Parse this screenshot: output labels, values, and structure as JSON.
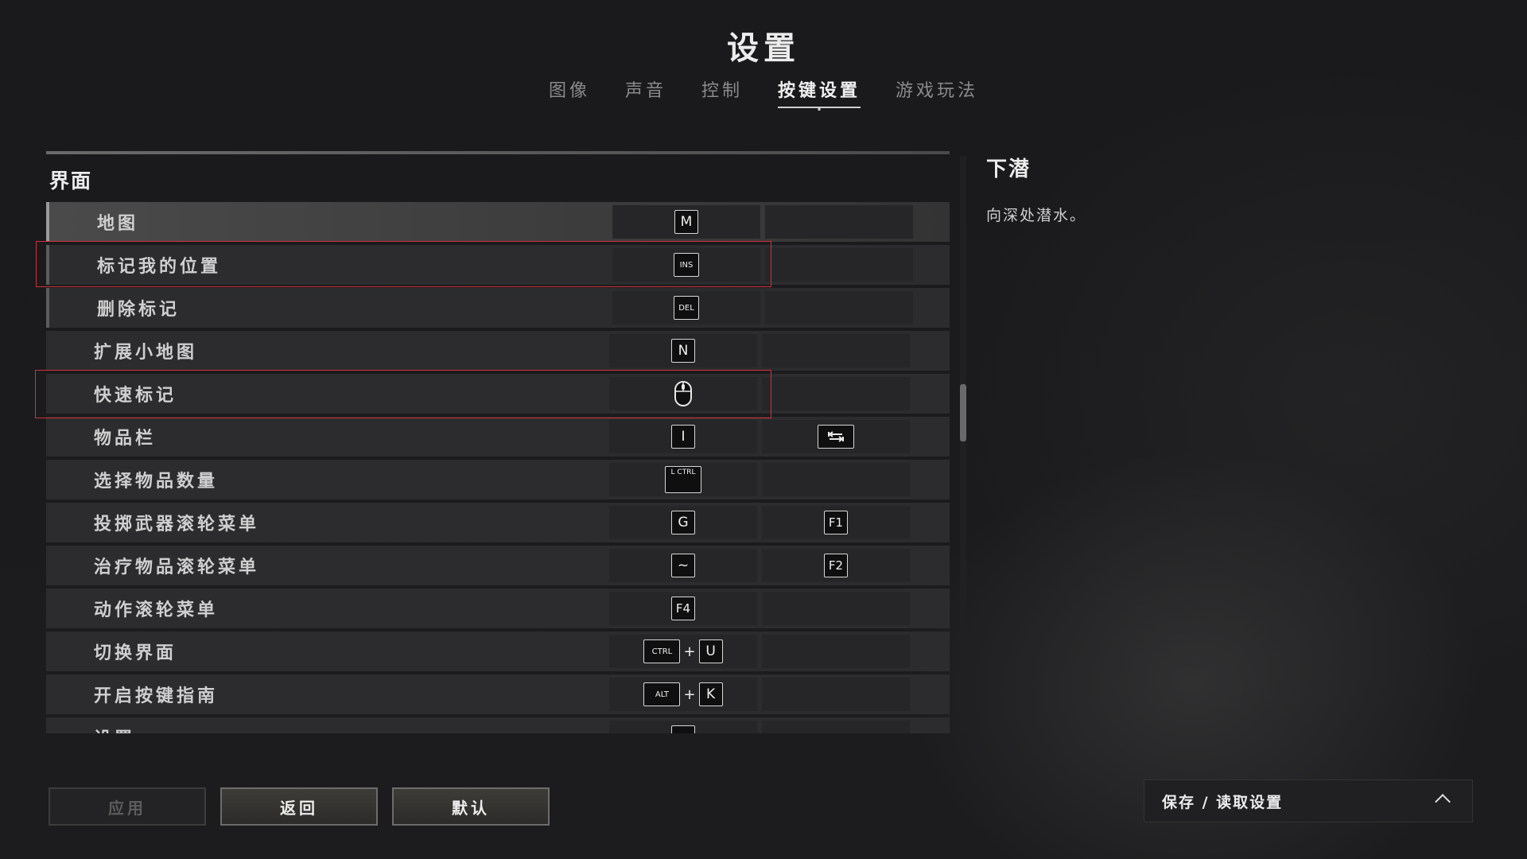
{
  "header": {
    "title": "设置"
  },
  "tabs": [
    {
      "label": "图像"
    },
    {
      "label": "声音"
    },
    {
      "label": "控制"
    },
    {
      "label": "按键设置",
      "active": true
    },
    {
      "label": "游戏玩法"
    }
  ],
  "section": {
    "title": "界面"
  },
  "bindings": [
    {
      "label": "地图",
      "primary": "M",
      "secondary": ""
    },
    {
      "label": "标记我的位置",
      "primary": "INS",
      "secondary": ""
    },
    {
      "label": "删除标记",
      "primary": "DEL",
      "secondary": ""
    },
    {
      "label": "扩展小地图",
      "primary": "N",
      "secondary": ""
    },
    {
      "label": "快速标记",
      "primary": "mouse-middle-icon",
      "secondary": ""
    },
    {
      "label": "物品栏",
      "primary": "I",
      "secondary": "tab-key-icon"
    },
    {
      "label": "选择物品数量",
      "primary": "L CTRL",
      "secondary": ""
    },
    {
      "label": "投掷武器滚轮菜单",
      "primary": "G",
      "secondary": "F1"
    },
    {
      "label": "治疗物品滚轮菜单",
      "primary": "~",
      "secondary": "F2"
    },
    {
      "label": "动作滚轮菜单",
      "primary": "F4",
      "secondary": ""
    },
    {
      "label": "切换界面",
      "primary_mod": "CTRL",
      "primary": "U",
      "secondary": ""
    },
    {
      "label": "开启按键指南",
      "primary_mod": "ALT",
      "primary": "K",
      "secondary": ""
    },
    {
      "label": "设置",
      "primary": "",
      "secondary": ""
    }
  ],
  "detail": {
    "title": "下潜",
    "description": "向深处潜水。"
  },
  "buttons": {
    "apply": "应用",
    "back": "返回",
    "default": "默认"
  },
  "saveload": {
    "label": "保存 / 读取设置"
  },
  "scroll": {
    "position_fraction": 0.44
  }
}
